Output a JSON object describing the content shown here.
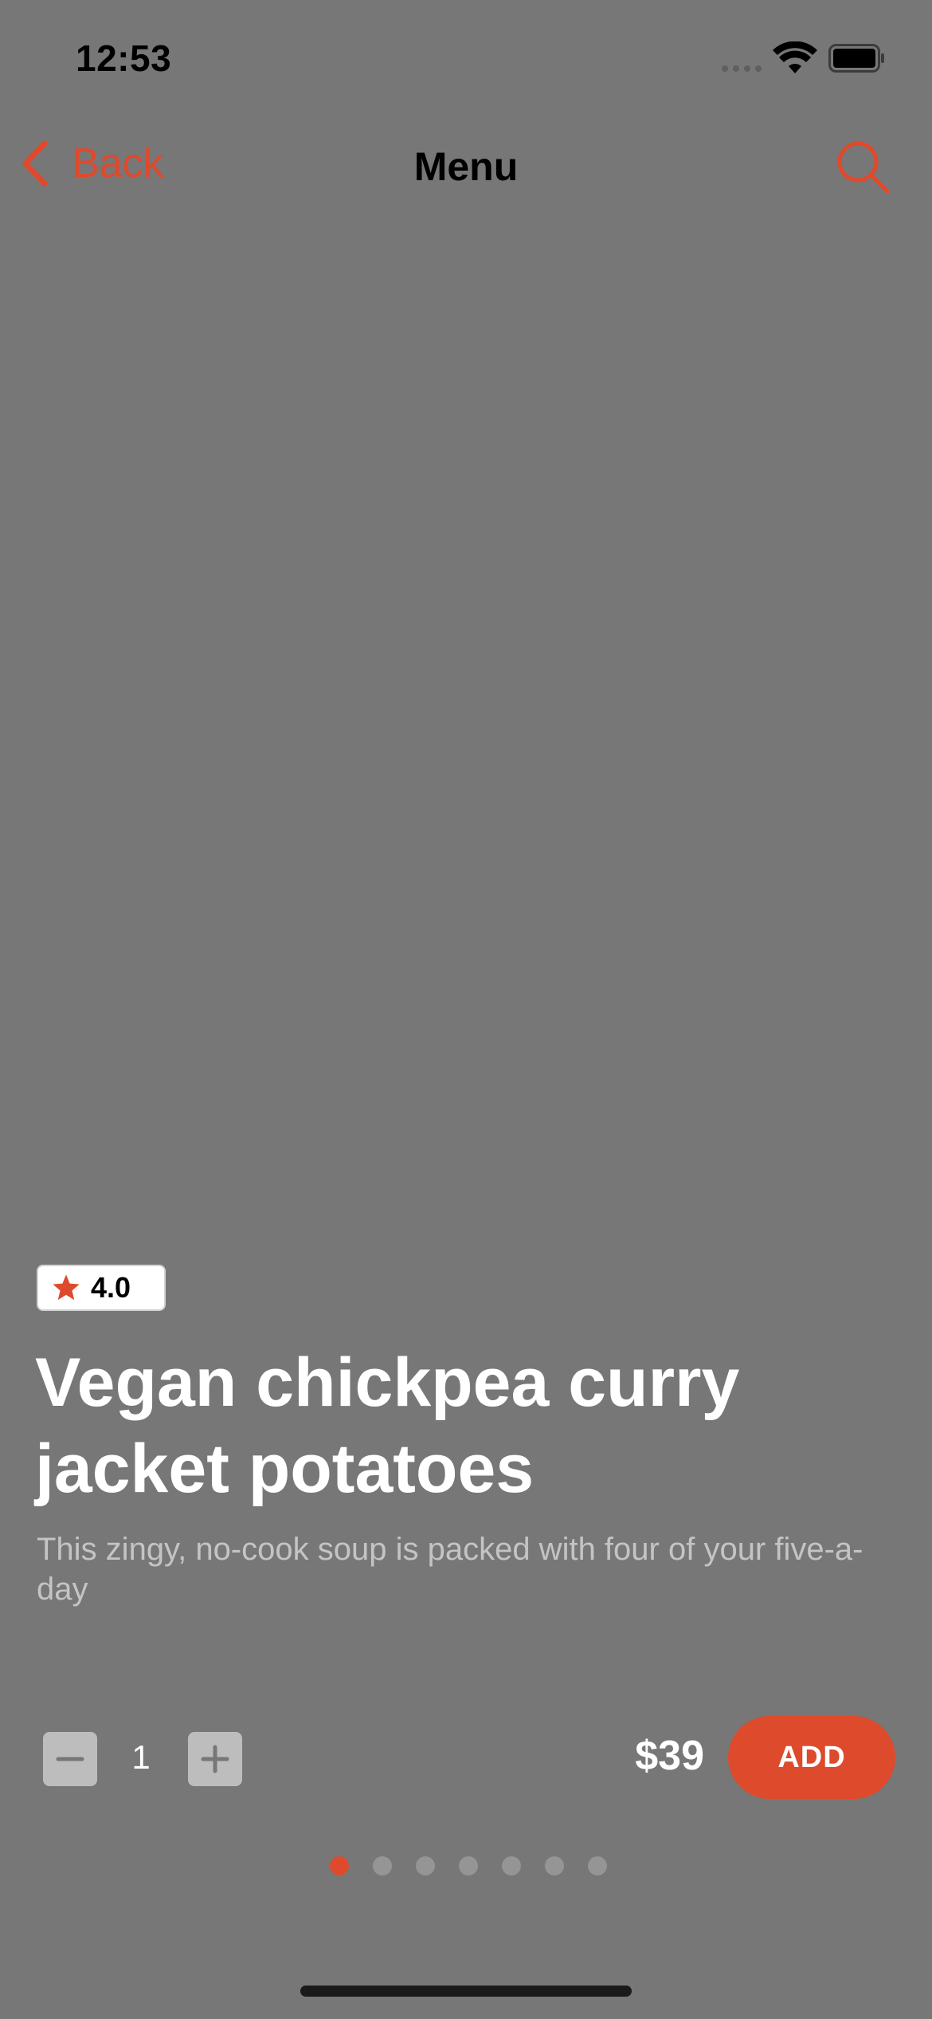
{
  "status_bar": {
    "time": "12:53"
  },
  "nav": {
    "back_label": "Back",
    "title": "Menu"
  },
  "product": {
    "rating": "4.0",
    "title": "Vegan chickpea curry jacket potatoes",
    "description": "This zingy, no-cook soup is packed with four of your five-a-day",
    "quantity": "1",
    "price": "$39",
    "add_label": "ADD"
  },
  "pagination": {
    "total": 7,
    "current": 1
  },
  "colors": {
    "accent": "#de4a2c",
    "background": "#777777"
  },
  "icons": [
    "chevron-left-icon",
    "search-icon",
    "star-icon",
    "minus-icon",
    "plus-icon",
    "wifi-icon",
    "battery-icon",
    "cellular-signal-icon"
  ]
}
